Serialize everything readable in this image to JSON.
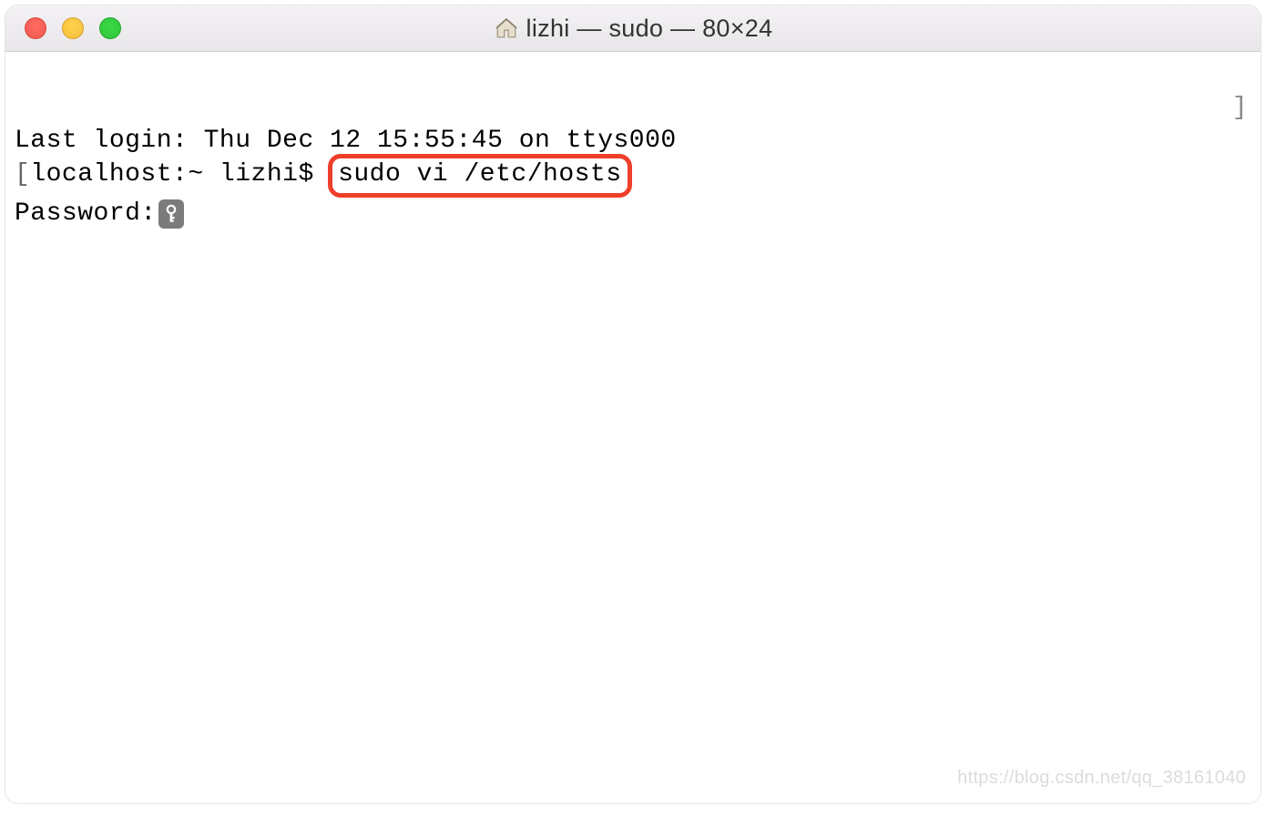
{
  "window": {
    "title": "lizhi — sudo — 80×24"
  },
  "terminal": {
    "last_login": "Last login: Thu Dec 12 15:55:45 on ttys000",
    "prompt_prefix": "[",
    "prompt": "localhost:~ lizhi$ ",
    "command": "sudo vi /etc/hosts",
    "password_label": "Password:",
    "bracket_right": "]"
  },
  "watermark": "https://blog.csdn.net/qq_38161040",
  "icons": {
    "home": "home-icon",
    "key": "key-icon"
  }
}
